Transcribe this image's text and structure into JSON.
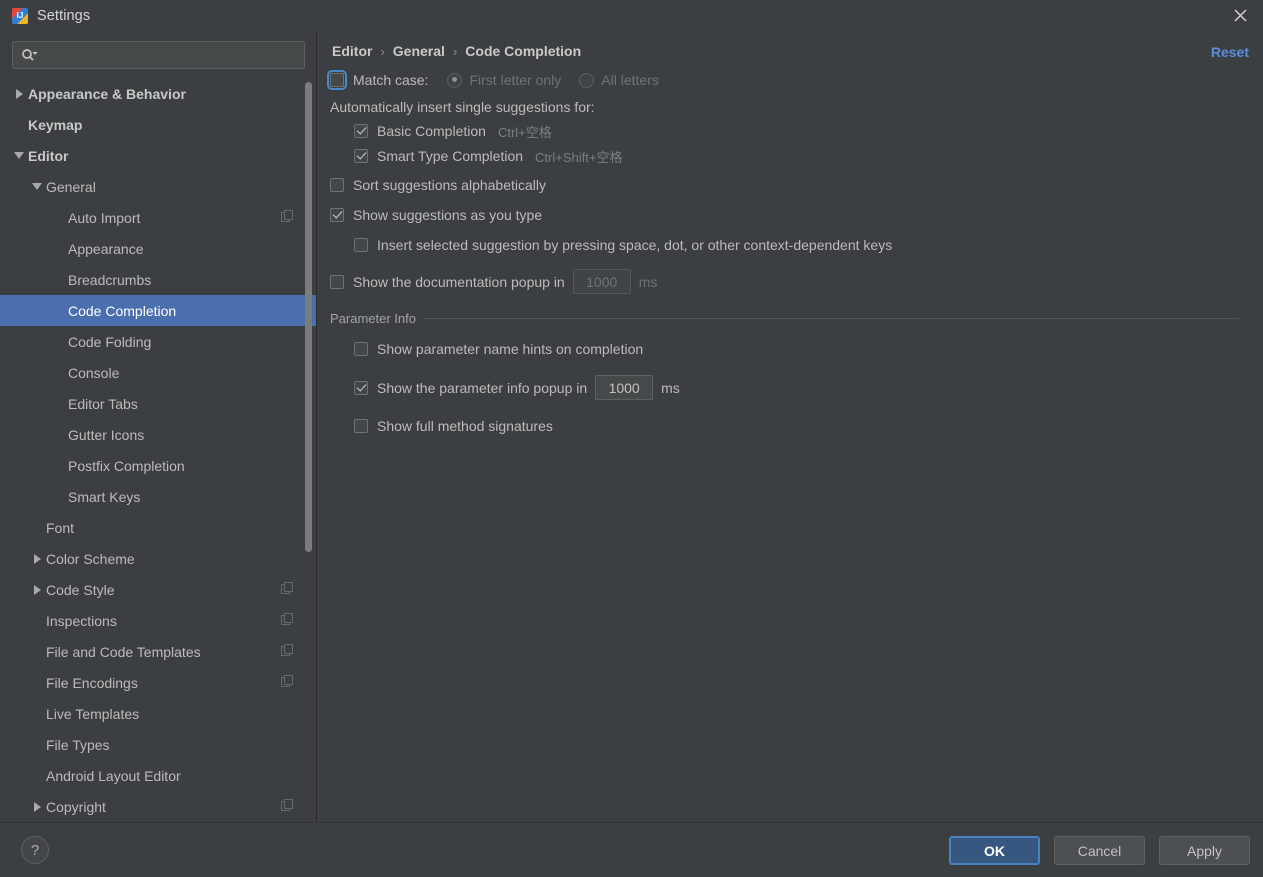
{
  "window": {
    "title": "Settings",
    "icon": "intellij-idea-icon",
    "close_label": "×"
  },
  "sidebar": {
    "search": {
      "value": "",
      "placeholder": "",
      "icon": "search-icon"
    },
    "items": [
      {
        "label": "Appearance & Behavior",
        "depth": 0,
        "twisty": "right",
        "bold": true,
        "selected": false,
        "copy_icon": false
      },
      {
        "label": "Keymap",
        "depth": 0,
        "twisty": "none",
        "bold": true,
        "selected": false,
        "copy_icon": false
      },
      {
        "label": "Editor",
        "depth": 0,
        "twisty": "down",
        "bold": true,
        "selected": false,
        "copy_icon": false
      },
      {
        "label": "General",
        "depth": 1,
        "twisty": "down",
        "bold": false,
        "selected": false,
        "copy_icon": false
      },
      {
        "label": "Auto Import",
        "depth": 2,
        "twisty": "none",
        "bold": false,
        "selected": false,
        "copy_icon": true
      },
      {
        "label": "Appearance",
        "depth": 2,
        "twisty": "none",
        "bold": false,
        "selected": false,
        "copy_icon": false
      },
      {
        "label": "Breadcrumbs",
        "depth": 2,
        "twisty": "none",
        "bold": false,
        "selected": false,
        "copy_icon": false
      },
      {
        "label": "Code Completion",
        "depth": 2,
        "twisty": "none",
        "bold": false,
        "selected": true,
        "copy_icon": false
      },
      {
        "label": "Code Folding",
        "depth": 2,
        "twisty": "none",
        "bold": false,
        "selected": false,
        "copy_icon": false
      },
      {
        "label": "Console",
        "depth": 2,
        "twisty": "none",
        "bold": false,
        "selected": false,
        "copy_icon": false
      },
      {
        "label": "Editor Tabs",
        "depth": 2,
        "twisty": "none",
        "bold": false,
        "selected": false,
        "copy_icon": false
      },
      {
        "label": "Gutter Icons",
        "depth": 2,
        "twisty": "none",
        "bold": false,
        "selected": false,
        "copy_icon": false
      },
      {
        "label": "Postfix Completion",
        "depth": 2,
        "twisty": "none",
        "bold": false,
        "selected": false,
        "copy_icon": false
      },
      {
        "label": "Smart Keys",
        "depth": 2,
        "twisty": "none",
        "bold": false,
        "selected": false,
        "copy_icon": false
      },
      {
        "label": "Font",
        "depth": 1,
        "twisty": "none",
        "bold": false,
        "selected": false,
        "copy_icon": false
      },
      {
        "label": "Color Scheme",
        "depth": 1,
        "twisty": "right",
        "bold": false,
        "selected": false,
        "copy_icon": false
      },
      {
        "label": "Code Style",
        "depth": 1,
        "twisty": "right",
        "bold": false,
        "selected": false,
        "copy_icon": true
      },
      {
        "label": "Inspections",
        "depth": 1,
        "twisty": "none",
        "bold": false,
        "selected": false,
        "copy_icon": true
      },
      {
        "label": "File and Code Templates",
        "depth": 1,
        "twisty": "none",
        "bold": false,
        "selected": false,
        "copy_icon": true
      },
      {
        "label": "File Encodings",
        "depth": 1,
        "twisty": "none",
        "bold": false,
        "selected": false,
        "copy_icon": true
      },
      {
        "label": "Live Templates",
        "depth": 1,
        "twisty": "none",
        "bold": false,
        "selected": false,
        "copy_icon": false
      },
      {
        "label": "File Types",
        "depth": 1,
        "twisty": "none",
        "bold": false,
        "selected": false,
        "copy_icon": false
      },
      {
        "label": "Android Layout Editor",
        "depth": 1,
        "twisty": "none",
        "bold": false,
        "selected": false,
        "copy_icon": false
      },
      {
        "label": "Copyright",
        "depth": 1,
        "twisty": "right",
        "bold": false,
        "selected": false,
        "copy_icon": true
      }
    ]
  },
  "main": {
    "breadcrumb": {
      "part1": "Editor",
      "part2": "General",
      "part3": "Code Completion",
      "separator": "›"
    },
    "reset_label": "Reset",
    "match_case": {
      "label": "Match case:",
      "checked": false,
      "focused": true,
      "options": [
        {
          "label": "First letter only",
          "selected": true,
          "disabled": true
        },
        {
          "label": "All letters",
          "selected": false,
          "disabled": true
        }
      ]
    },
    "auto_insert_header": "Automatically insert single suggestions for:",
    "auto_insert_items": [
      {
        "label": "Basic Completion",
        "shortcut": "Ctrl+空格",
        "checked": true
      },
      {
        "label": "Smart Type Completion",
        "shortcut": "Ctrl+Shift+空格",
        "checked": true
      }
    ],
    "options": [
      {
        "label": "Sort suggestions alphabetically",
        "checked": false,
        "indent": 0
      },
      {
        "label": "Show suggestions as you type",
        "checked": true,
        "indent": 0
      },
      {
        "label": "Insert selected suggestion by pressing space, dot, or other context-dependent keys",
        "checked": false,
        "indent": 1
      }
    ],
    "doc_popup": {
      "label": "Show the documentation popup in",
      "checked": false,
      "value": "1000",
      "unit": "ms",
      "disabled": true
    },
    "parameter_info": {
      "title": "Parameter Info",
      "rows": [
        {
          "label": "Show parameter name hints on completion",
          "checked": false,
          "type": "checkbox"
        },
        {
          "label": "Show the parameter info popup in",
          "checked": true,
          "type": "spinner",
          "value": "1000",
          "unit": "ms"
        },
        {
          "label": "Show full method signatures",
          "checked": false,
          "type": "checkbox"
        }
      ]
    }
  },
  "footer": {
    "help_label": "?",
    "buttons": [
      {
        "label": "OK",
        "primary": true
      },
      {
        "label": "Cancel",
        "primary": false
      },
      {
        "label": "Apply",
        "primary": false
      }
    ]
  },
  "colors": {
    "background": "#3c3f41",
    "selection": "#4b6eaf",
    "link": "#5a8ddb",
    "primary_button": "#365880",
    "text": "#bbbbbb",
    "disabled_text": "#6f7375"
  }
}
